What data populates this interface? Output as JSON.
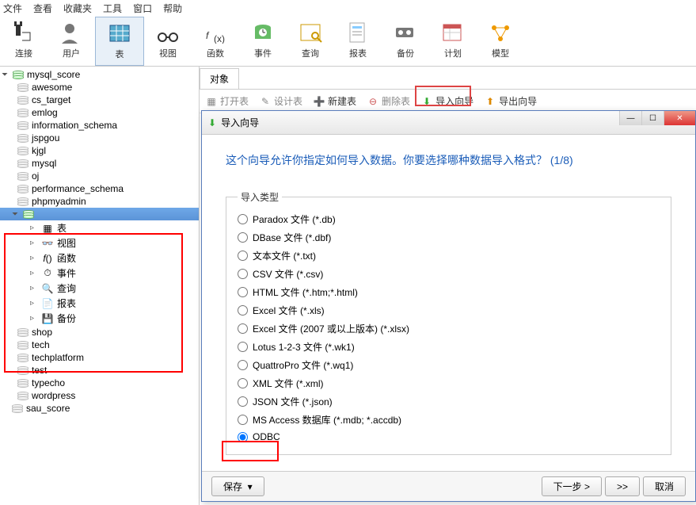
{
  "menu": [
    "文件",
    "查看",
    "收藏夹",
    "工具",
    "窗口",
    "帮助"
  ],
  "toolbar": [
    {
      "label": "连接",
      "svg": "plug"
    },
    {
      "label": "用户",
      "svg": "user"
    },
    {
      "label": "表",
      "svg": "table",
      "active": true
    },
    {
      "label": "视图",
      "svg": "view"
    },
    {
      "label": "函数",
      "svg": "fx"
    },
    {
      "label": "事件",
      "svg": "event"
    },
    {
      "label": "查询",
      "svg": "query"
    },
    {
      "label": "报表",
      "svg": "report"
    },
    {
      "label": "备份",
      "svg": "backup"
    },
    {
      "label": "计划",
      "svg": "plan"
    },
    {
      "label": "模型",
      "svg": "model"
    }
  ],
  "tree": {
    "root": "mysql_score",
    "dbs": [
      "awesome",
      "cs_target",
      "emlog",
      "information_schema",
      "jspgou",
      "kjgl",
      "mysql",
      "oj",
      "performance_schema",
      "phpmyadmin"
    ],
    "selected_children": [
      {
        "label": "表",
        "icon": "table"
      },
      {
        "label": "视图",
        "icon": "view"
      },
      {
        "label": "函数",
        "icon": "fx"
      },
      {
        "label": "事件",
        "icon": "event"
      },
      {
        "label": "查询",
        "icon": "query"
      },
      {
        "label": "报表",
        "icon": "report"
      },
      {
        "label": "备份",
        "icon": "backup"
      }
    ],
    "dbs_after": [
      "shop",
      "tech",
      "techplatform",
      "test",
      "typecho",
      "wordpress"
    ],
    "last": "sau_score"
  },
  "content_tab": "对象",
  "tablebar": {
    "open": "打开表",
    "design": "设计表",
    "new": "新建表",
    "delete": "删除表",
    "import": "导入向导",
    "export": "导出向导"
  },
  "dlg": {
    "title": "导入向导",
    "h": "这个向导允许你指定如何导入数据。你要选择哪种数据导入格式？ (1/8)",
    "legend": "导入类型",
    "opts": [
      "Paradox 文件 (*.db)",
      "DBase 文件 (*.dbf)",
      "文本文件 (*.txt)",
      "CSV 文件 (*.csv)",
      "HTML 文件 (*.htm;*.html)",
      "Excel 文件 (*.xls)",
      "Excel 文件 (2007 或以上版本) (*.xlsx)",
      "Lotus 1-2-3 文件 (*.wk1)",
      "QuattroPro 文件 (*.wq1)",
      "XML 文件 (*.xml)",
      "JSON 文件 (*.json)",
      "MS Access 数据库 (*.mdb; *.accdb)",
      "ODBC"
    ],
    "selected": 12,
    "save": "保存",
    "next": "下一步 >",
    "last": ">>",
    "cancel": "取消"
  }
}
